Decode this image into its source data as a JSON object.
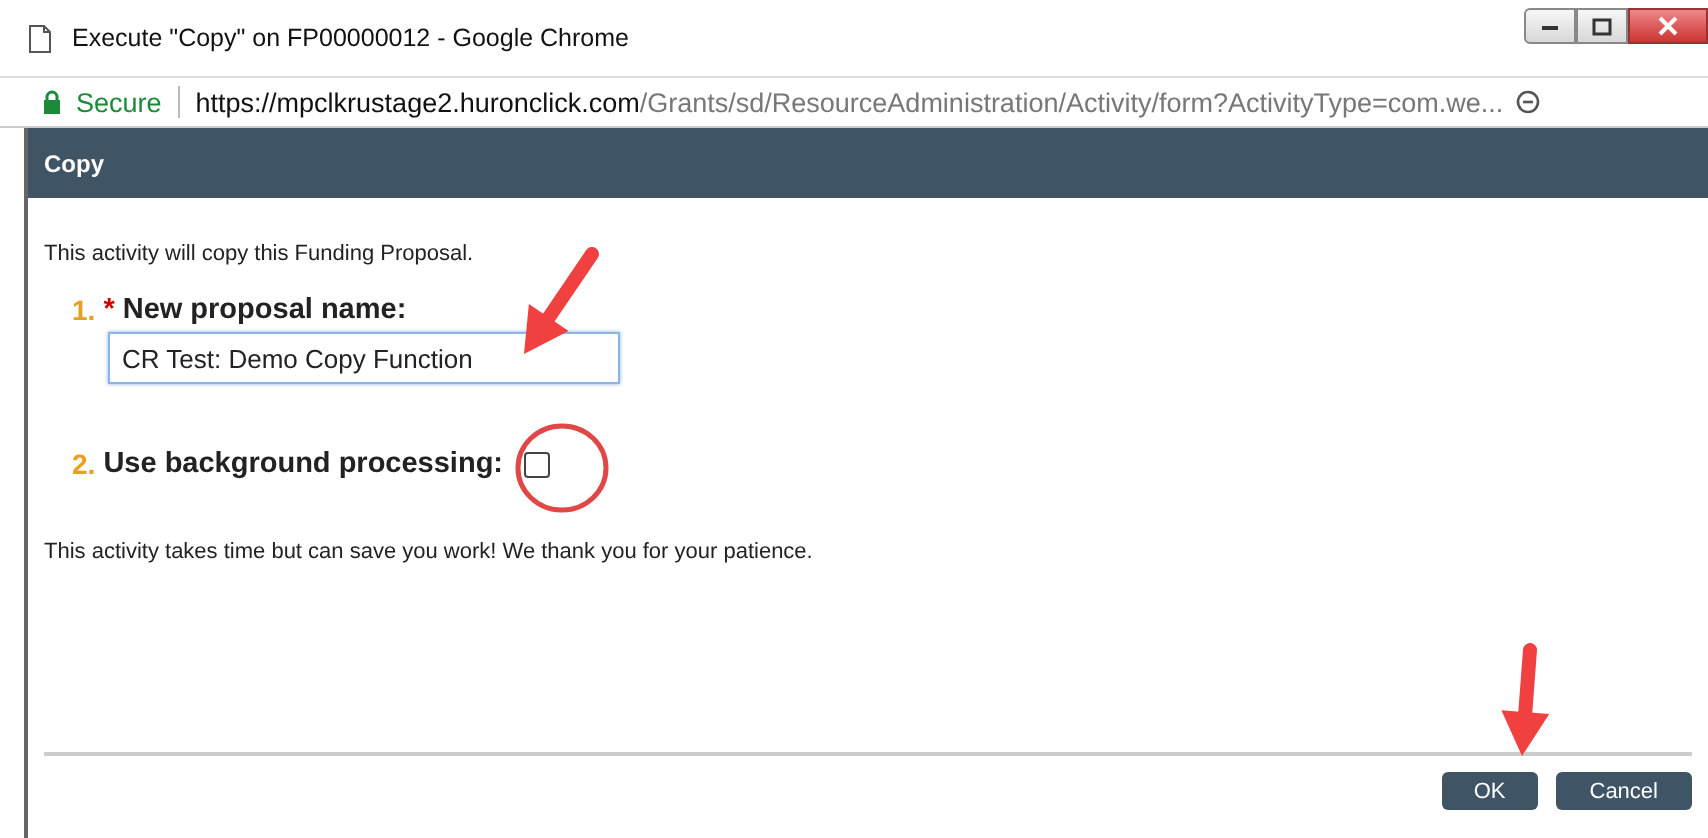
{
  "window": {
    "title": "Execute \"Copy\" on FP00000012 - Google Chrome"
  },
  "address_bar": {
    "secure_label": "Secure",
    "url_host": "https://mpclkrustage2.huronclick.com",
    "url_path": "/Grants/sd/ResourceAdministration/Activity/form?ActivityType=com.we..."
  },
  "dialog": {
    "title": "Copy",
    "intro": "This activity will copy this Funding Proposal.",
    "fields": [
      {
        "kind": "text",
        "number": "1.",
        "required_mark": "*",
        "label": "New proposal name:",
        "value": "CR Test: Demo Copy Function"
      },
      {
        "kind": "checkbox",
        "number": "2.",
        "label": "Use background processing:",
        "checked": false
      }
    ],
    "note": "This activity takes time but can save you work! We thank you for your patience.",
    "buttons": [
      "OK",
      "Cancel"
    ]
  }
}
